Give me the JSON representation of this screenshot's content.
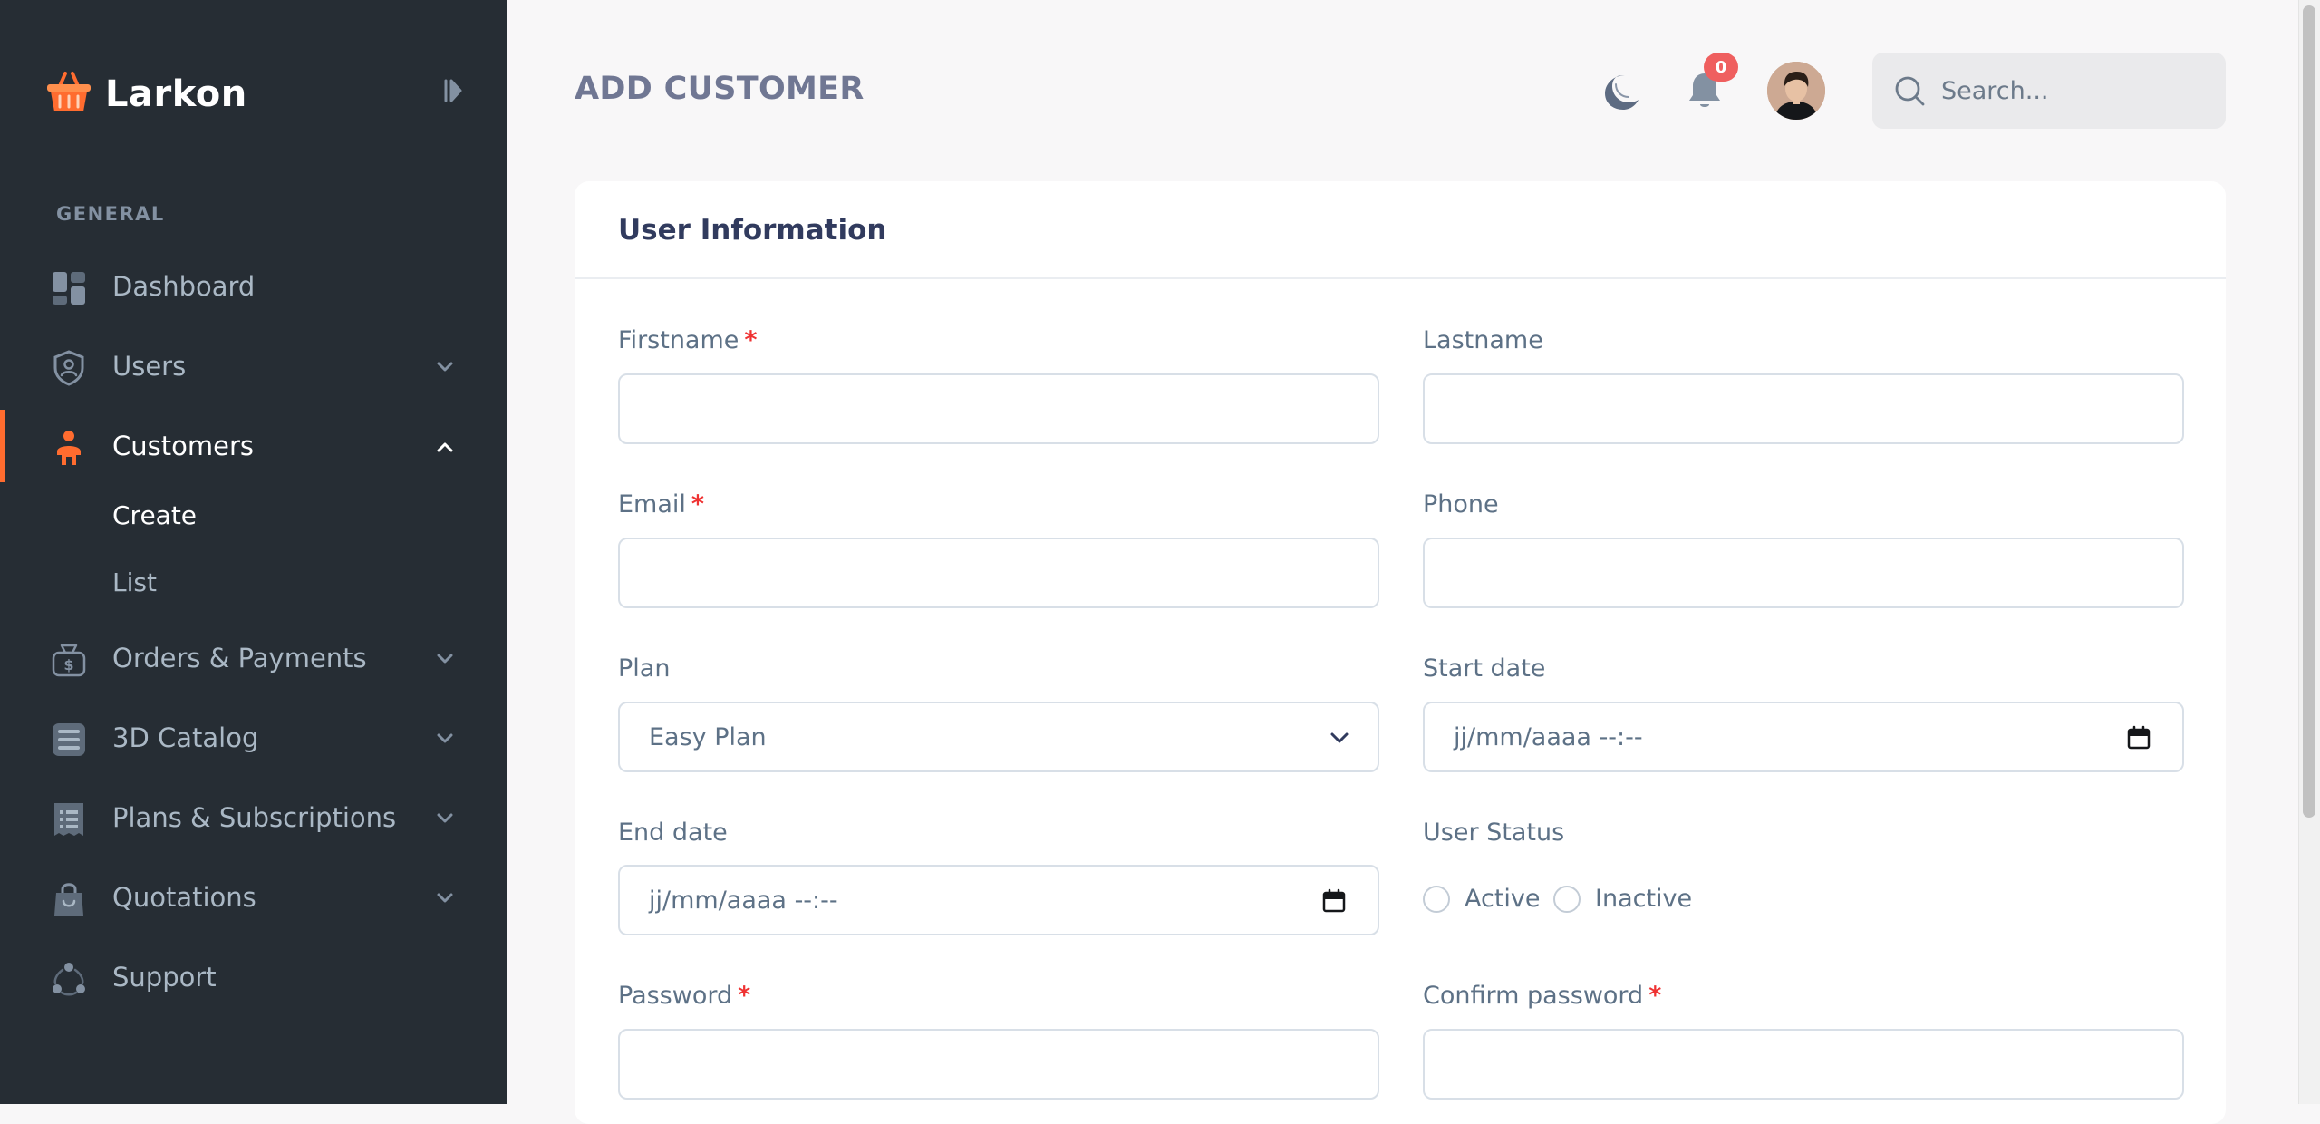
{
  "brand": {
    "name": "Larkon"
  },
  "sidebar": {
    "section_title": "GENERAL",
    "items": [
      {
        "label": "Dashboard",
        "icon": "dashboard-icon",
        "has_chevron": false
      },
      {
        "label": "Users",
        "icon": "user-shield-icon",
        "has_chevron": true
      },
      {
        "label": "Customers",
        "icon": "customer-icon",
        "has_chevron": true,
        "active": true,
        "expanded": true
      },
      {
        "label": "Orders & Payments",
        "icon": "money-bag-icon",
        "has_chevron": true
      },
      {
        "label": "3D Catalog",
        "icon": "catalog-icon",
        "has_chevron": true
      },
      {
        "label": "Plans & Subscriptions",
        "icon": "receipt-icon",
        "has_chevron": true
      },
      {
        "label": "Quotations",
        "icon": "shopping-bag-icon",
        "has_chevron": true
      },
      {
        "label": "Support",
        "icon": "support-icon",
        "has_chevron": false
      }
    ],
    "customers_sub": [
      {
        "label": "Create",
        "active": true
      },
      {
        "label": "List",
        "active": false
      }
    ]
  },
  "header": {
    "page_title": "ADD CUSTOMER",
    "notification_count": "0",
    "search_placeholder": "Search..."
  },
  "form": {
    "card_title": "User Information",
    "firstname_label": "Firstname",
    "lastname_label": "Lastname",
    "email_label": "Email",
    "phone_label": "Phone",
    "plan_label": "Plan",
    "plan_value": "Easy Plan",
    "start_date_label": "Start date",
    "start_date_placeholder": "jj/mm/aaaa --:--",
    "end_date_label": "End date",
    "end_date_placeholder": "jj/mm/aaaa --:--",
    "user_status_label": "User Status",
    "status_options": [
      "Active",
      "Inactive"
    ],
    "password_label": "Password",
    "confirm_password_label": "Confirm password",
    "required_mark": "*"
  },
  "colors": {
    "sidebar_bg": "#262d34",
    "accent": "#ff6c2f",
    "required": "#ef3232",
    "badge": "#ef5f5f"
  }
}
